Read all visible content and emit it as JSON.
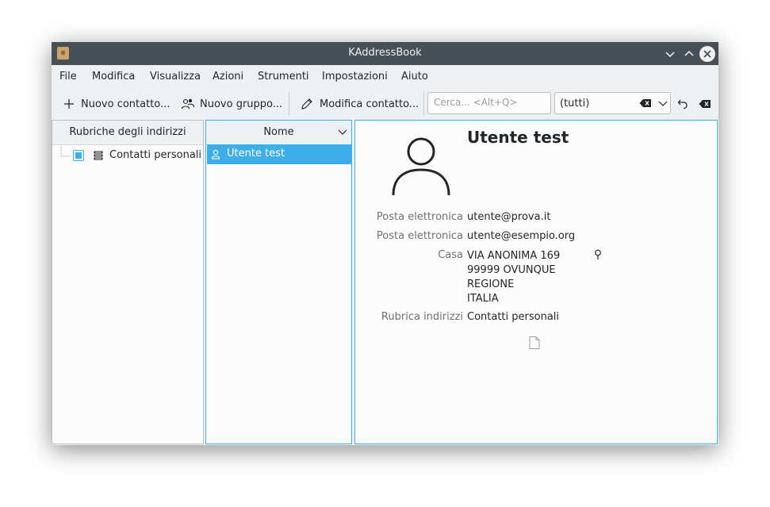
{
  "window": {
    "title": "KAddressBook"
  },
  "menu": [
    "File",
    "Modifica",
    "Visualizza",
    "Azioni",
    "Strumenti",
    "Impostazioni",
    "Aiuto"
  ],
  "toolbar": {
    "new_contact": "Nuovo contatto...",
    "new_group": "Nuovo gruppo...",
    "edit_contact": "Modifica contatto...",
    "search_placeholder": "Cerca... <Alt+Q>",
    "filter_value": "(tutti)"
  },
  "addressbooks": {
    "header": "Rubriche degli indirizzi",
    "items": [
      {
        "label": "Contatti personali",
        "checked": true
      }
    ]
  },
  "contact_list": {
    "header": "Nome",
    "items": [
      {
        "name": "Utente test",
        "selected": true
      }
    ]
  },
  "contact": {
    "name": "Utente test",
    "fields": [
      {
        "label": "Posta elettronica",
        "value": "utente@prova.it"
      },
      {
        "label": "Posta elettronica",
        "value": "utente@esempio.org"
      },
      {
        "label": "Casa",
        "lines": [
          "VIA ANONIMA 169",
          "99999 OVUNQUE",
          "REGIONE",
          "ITALIA"
        ]
      },
      {
        "label": "Rubrica indirizzi",
        "value": "Contatti personali"
      }
    ]
  },
  "colors": {
    "accent": "#3daee9",
    "titlebar": "#475057",
    "background": "#eff0f1"
  },
  "icons": [
    "app-icon",
    "minimize-icon",
    "maximize-icon",
    "close-icon",
    "plus-icon",
    "group-icon",
    "pencil-icon",
    "clear-text-icon",
    "chevron-down-icon",
    "undo-icon",
    "addressbook-icon",
    "person-icon",
    "avatar-icon",
    "map-pin-icon",
    "vcard-icon"
  ]
}
